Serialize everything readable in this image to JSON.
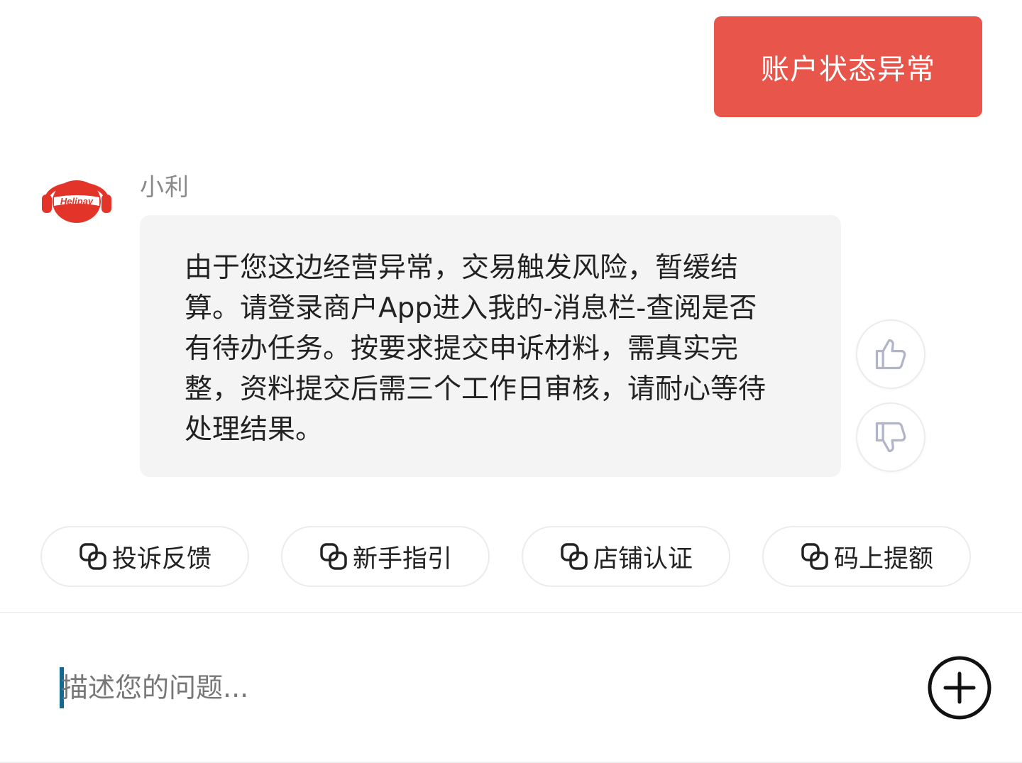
{
  "user_message": {
    "text": "账户状态异常",
    "bubble_color": "#e8554b"
  },
  "bot": {
    "name": "小利",
    "avatar_brand": "Helipay",
    "avatar_color": "#e3342a",
    "message": "由于您这边经营异常，交易触发风险，暂缓结算。请登录商户App进入我的-消息栏-查阅是否有待办任务。按要求提交申诉材料，需真实完整，资料提交后需三个工作日审核，请耐心等待处理结果。"
  },
  "feedback": {
    "like_icon": "thumbs-up-icon",
    "dislike_icon": "thumbs-down-icon"
  },
  "quick_actions": [
    {
      "label": "投诉反馈",
      "icon": "link-icon"
    },
    {
      "label": "新手指引",
      "icon": "link-icon"
    },
    {
      "label": "店铺认证",
      "icon": "link-icon"
    },
    {
      "label": "码上提额",
      "icon": "link-icon"
    }
  ],
  "input": {
    "placeholder": "描述您的问题...",
    "value": "",
    "add_icon": "plus-circle-icon"
  }
}
